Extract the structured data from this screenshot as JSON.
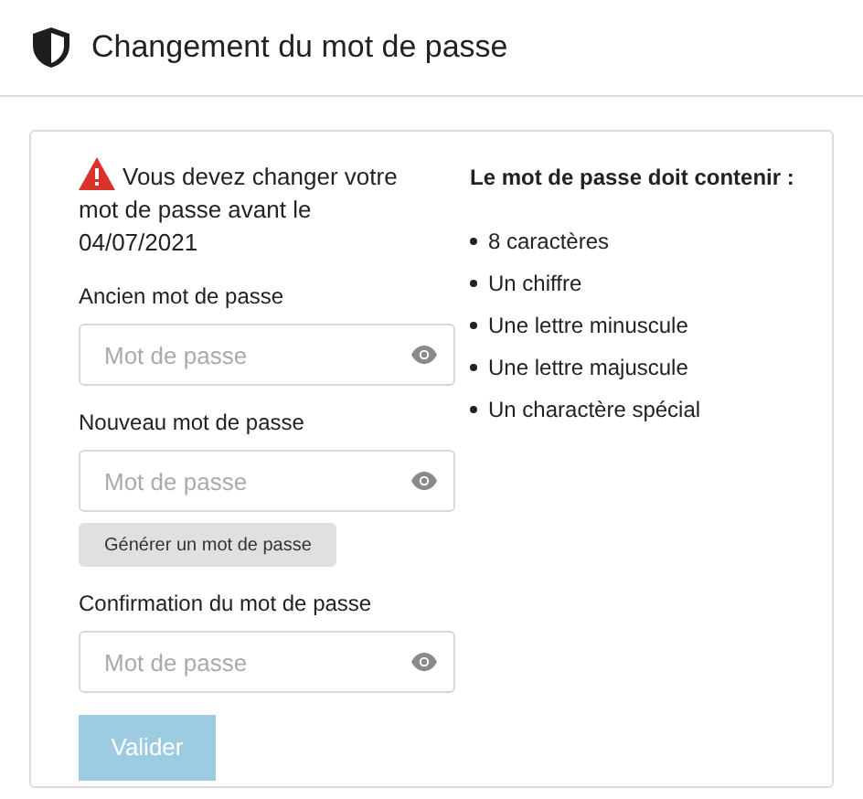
{
  "header": {
    "title": "Changement du mot de passe"
  },
  "warning": {
    "text": "Vous devez changer votre mot de passe avant le 04/07/2021"
  },
  "fields": [
    {
      "label": "Ancien mot de passe",
      "placeholder": "Mot de passe"
    },
    {
      "label": "Nouveau mot de passe",
      "placeholder": "Mot de passe",
      "action": "Générer un mot de passe"
    },
    {
      "label": "Confirmation du mot de passe",
      "placeholder": "Mot de passe"
    }
  ],
  "submit": {
    "label": "Valider",
    "disabled": true
  },
  "rules": {
    "title": "Le mot de passe doit contenir :",
    "items": [
      "8 caractères",
      "Un chiffre",
      "Une lettre minuscule",
      "Une lettre majuscule",
      "Un charactère spécial"
    ]
  }
}
